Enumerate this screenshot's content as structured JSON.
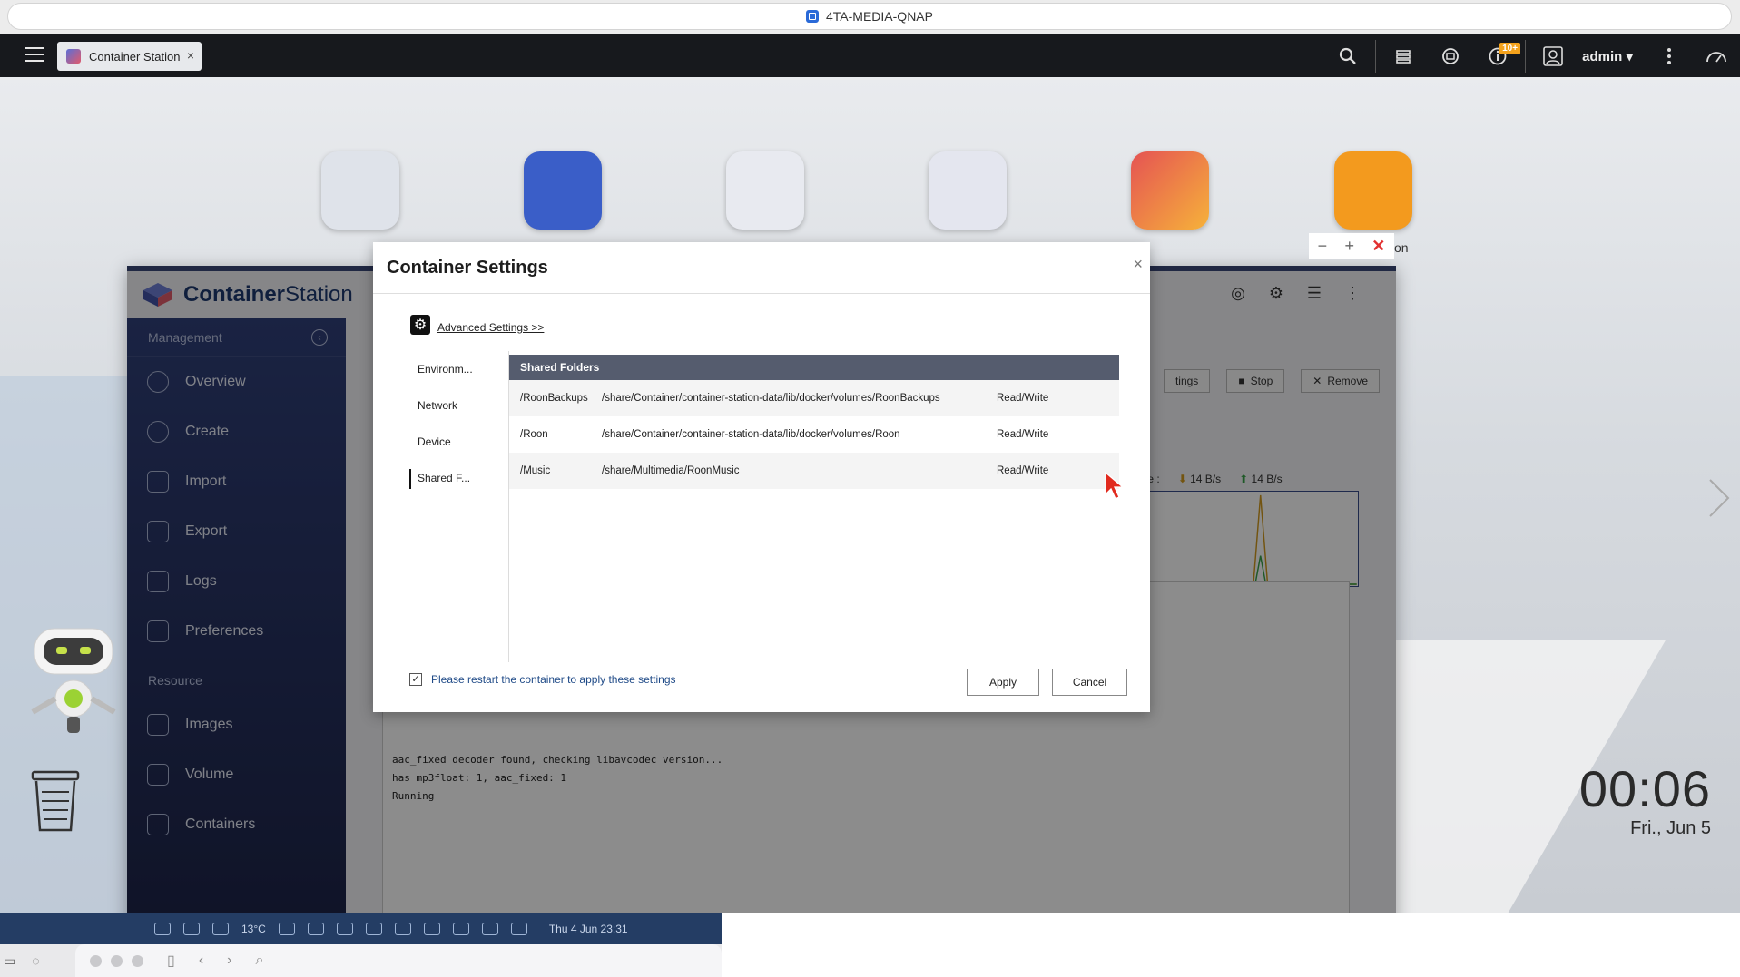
{
  "browser": {
    "title": "4TA-MEDIA-QNAP"
  },
  "qts": {
    "tab_label": "Container Station",
    "tab_close": "×",
    "notification_badge": "10+",
    "user": "admin"
  },
  "app": {
    "name_bold": "Container",
    "name_rest": "Station"
  },
  "sidebar": {
    "management": "Management",
    "resource": "Resource",
    "items": [
      {
        "label": "Overview",
        "icon": "gauge-icon"
      },
      {
        "label": "Create",
        "icon": "plus-circle-icon"
      },
      {
        "label": "Import",
        "icon": "import-icon"
      },
      {
        "label": "Export",
        "icon": "export-icon"
      },
      {
        "label": "Logs",
        "icon": "document-icon"
      },
      {
        "label": "Preferences",
        "icon": "sliders-icon"
      }
    ],
    "resource_items": [
      {
        "label": "Images",
        "icon": "layers-icon"
      },
      {
        "label": "Volume",
        "icon": "cylinder-icon"
      },
      {
        "label": "Containers",
        "icon": "cube-icon"
      }
    ]
  },
  "container_toolbar": {
    "settings": "tings",
    "stop": "Stop",
    "remove": "Remove",
    "usage_label": "age :",
    "download_rate": "14 B/s",
    "upload_rate": "14 B/s"
  },
  "console": {
    "lines": [
      "aac_fixed decoder found, checking libavcodec version...",
      "has mp3float: 1, aac_fixed: 1",
      "Running"
    ]
  },
  "modal": {
    "title": "Container Settings",
    "close": "×",
    "advanced_link": "Advanced Settings >>",
    "nav": [
      "Environm...",
      "Network",
      "Device",
      "Shared F..."
    ],
    "active_nav": "Shared F...",
    "table_header": "Shared Folders",
    "rows": [
      {
        "mount": "/RoonBackups",
        "path": "/share/Container/container-station-data/lib/docker/volumes/RoonBackups",
        "mode": "Read/Write"
      },
      {
        "mount": "/Roon",
        "path": "/share/Container/container-station-data/lib/docker/volumes/Roon",
        "mode": "Read/Write"
      },
      {
        "mount": "/Music",
        "path": "/share/Multimedia/RoonMusic",
        "mode": "Read/Write"
      }
    ],
    "restart_text": "Please restart the container to apply these settings",
    "restart_checked": true,
    "apply": "Apply",
    "cancel": "Cancel"
  },
  "desktop": {
    "time": "00:06",
    "date": "Fri., Jun 5",
    "partial_label": "on"
  },
  "mac": {
    "temperature": "13°C",
    "datetime": "Thu 4 Jun  23:31"
  }
}
